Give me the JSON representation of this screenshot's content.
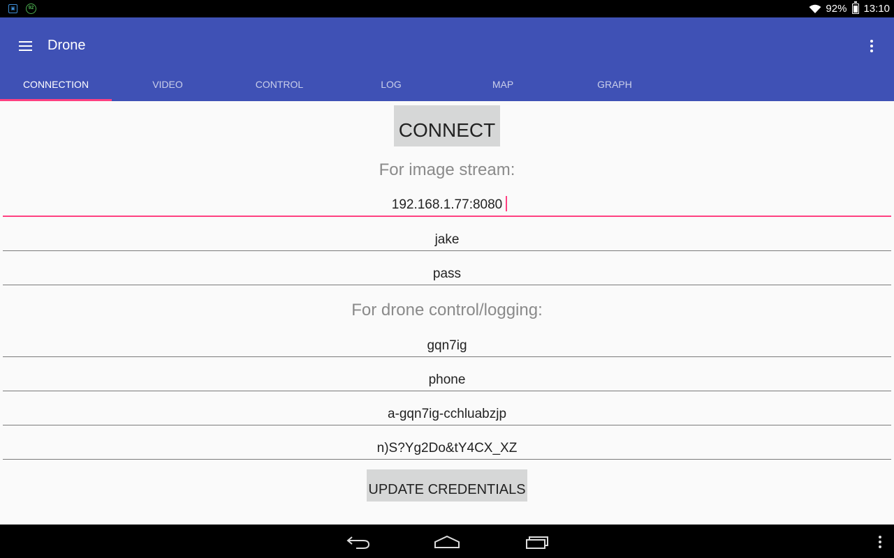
{
  "status_bar": {
    "notification_icon_1": "sim-card-icon",
    "notification_icon_2_text": "92",
    "wifi_icon": "wifi-icon",
    "battery_percent": "92%",
    "battery_icon": "battery-icon",
    "time": "13:10"
  },
  "app_bar": {
    "title": "Drone",
    "menu_icon": "hamburger-menu-icon",
    "overflow_icon": "more-vert-icon",
    "background_color": "#3f51b5",
    "indicator_color": "#ff4081"
  },
  "tabs": [
    {
      "label": "CONNECTION",
      "active": true
    },
    {
      "label": "VIDEO",
      "active": false
    },
    {
      "label": "CONTROL",
      "active": false
    },
    {
      "label": "LOG",
      "active": false
    },
    {
      "label": "MAP",
      "active": false
    },
    {
      "label": "GRAPH",
      "active": false
    }
  ],
  "connection": {
    "connect_label": "CONNECT",
    "image_stream_label": "For image stream:",
    "image_stream": {
      "address": "192.168.1.77:8080",
      "username": "jake",
      "password": "pass"
    },
    "drone_control_label": "For drone control/logging:",
    "drone_control": {
      "org_id": "gqn7ig",
      "device_type": "phone",
      "api_key": "a-gqn7ig-cchluabzjp",
      "auth_token": "n)S?Yg2Do&tY4CX_XZ"
    },
    "update_label": "UPDATE CREDENTIALS"
  },
  "nav_bar": {
    "back_icon": "back-icon",
    "home_icon": "home-icon",
    "recents_icon": "recents-icon",
    "menu_icon": "more-vert-icon"
  }
}
